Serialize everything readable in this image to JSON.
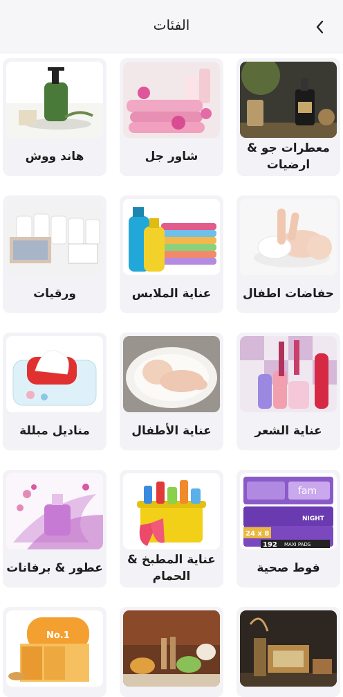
{
  "header": {
    "title": "الفئات",
    "back_icon": "chevron-left-icon"
  },
  "categories": [
    {
      "label": "معطرات جو & ارضيات",
      "image": "room-fragrance-image"
    },
    {
      "label": "شاور جل",
      "image": "shower-gel-image"
    },
    {
      "label": "هاند ووش",
      "image": "hand-wash-image"
    },
    {
      "label": "حفاضات اطفال",
      "image": "baby-diapers-image"
    },
    {
      "label": "عناية الملابس",
      "image": "laundry-care-image"
    },
    {
      "label": "ورقيات",
      "image": "paper-products-image"
    },
    {
      "label": "عناية الشعر",
      "image": "hair-care-image"
    },
    {
      "label": "عناية الأطفال",
      "image": "baby-care-image"
    },
    {
      "label": "مناديل مبللة",
      "image": "wet-wipes-image"
    },
    {
      "label": "فوط صحية",
      "image": "sanitary-pads-image"
    },
    {
      "label": "عناية المطبخ & الحمام",
      "image": "kitchen-bath-care-image"
    },
    {
      "label": "عطور & برفانات",
      "image": "perfumes-image"
    },
    {
      "label": "",
      "image": "home-decor-image"
    },
    {
      "label": "",
      "image": "kitchenware-image"
    },
    {
      "label": "",
      "image": "soap-bars-image"
    }
  ],
  "image_texts": {
    "fam_brand": "fam",
    "pads_count": "24 x 8",
    "pads_total": "192",
    "pads_desc": "MAXI PADS",
    "night": "NIGHT",
    "soap_brand": "No.1"
  }
}
